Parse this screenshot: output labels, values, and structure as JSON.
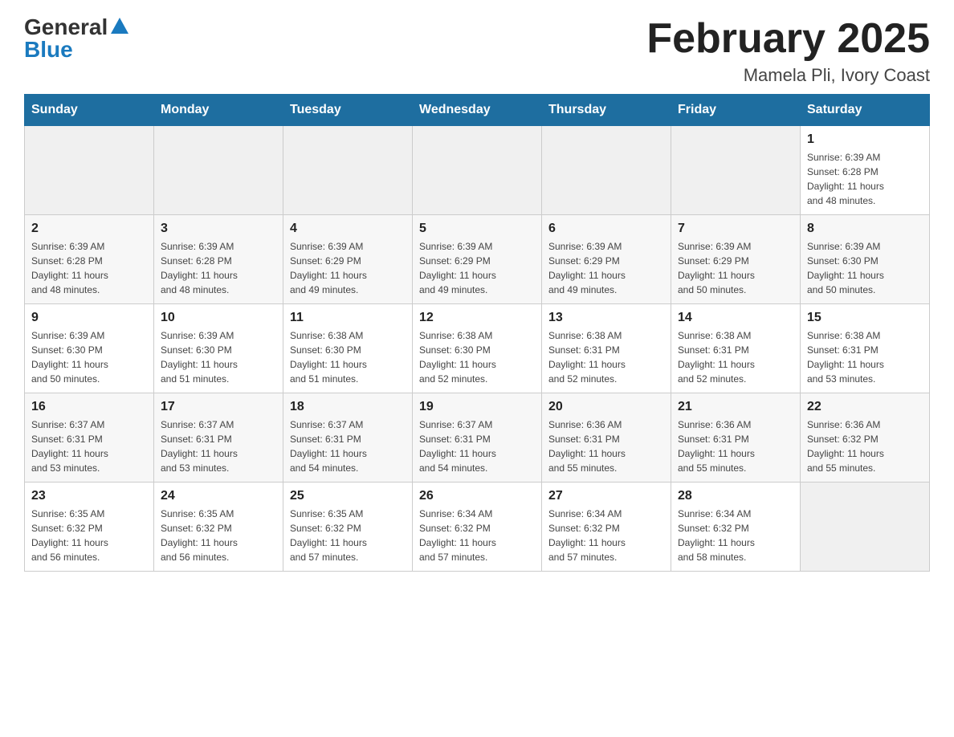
{
  "logo": {
    "general": "General",
    "blue": "Blue"
  },
  "title": "February 2025",
  "location": "Mamela Pli, Ivory Coast",
  "days_of_week": [
    "Sunday",
    "Monday",
    "Tuesday",
    "Wednesday",
    "Thursday",
    "Friday",
    "Saturday"
  ],
  "weeks": [
    [
      {
        "day": "",
        "detail": ""
      },
      {
        "day": "",
        "detail": ""
      },
      {
        "day": "",
        "detail": ""
      },
      {
        "day": "",
        "detail": ""
      },
      {
        "day": "",
        "detail": ""
      },
      {
        "day": "",
        "detail": ""
      },
      {
        "day": "1",
        "detail": "Sunrise: 6:39 AM\nSunset: 6:28 PM\nDaylight: 11 hours\nand 48 minutes."
      }
    ],
    [
      {
        "day": "2",
        "detail": "Sunrise: 6:39 AM\nSunset: 6:28 PM\nDaylight: 11 hours\nand 48 minutes."
      },
      {
        "day": "3",
        "detail": "Sunrise: 6:39 AM\nSunset: 6:28 PM\nDaylight: 11 hours\nand 48 minutes."
      },
      {
        "day": "4",
        "detail": "Sunrise: 6:39 AM\nSunset: 6:29 PM\nDaylight: 11 hours\nand 49 minutes."
      },
      {
        "day": "5",
        "detail": "Sunrise: 6:39 AM\nSunset: 6:29 PM\nDaylight: 11 hours\nand 49 minutes."
      },
      {
        "day": "6",
        "detail": "Sunrise: 6:39 AM\nSunset: 6:29 PM\nDaylight: 11 hours\nand 49 minutes."
      },
      {
        "day": "7",
        "detail": "Sunrise: 6:39 AM\nSunset: 6:29 PM\nDaylight: 11 hours\nand 50 minutes."
      },
      {
        "day": "8",
        "detail": "Sunrise: 6:39 AM\nSunset: 6:30 PM\nDaylight: 11 hours\nand 50 minutes."
      }
    ],
    [
      {
        "day": "9",
        "detail": "Sunrise: 6:39 AM\nSunset: 6:30 PM\nDaylight: 11 hours\nand 50 minutes."
      },
      {
        "day": "10",
        "detail": "Sunrise: 6:39 AM\nSunset: 6:30 PM\nDaylight: 11 hours\nand 51 minutes."
      },
      {
        "day": "11",
        "detail": "Sunrise: 6:38 AM\nSunset: 6:30 PM\nDaylight: 11 hours\nand 51 minutes."
      },
      {
        "day": "12",
        "detail": "Sunrise: 6:38 AM\nSunset: 6:30 PM\nDaylight: 11 hours\nand 52 minutes."
      },
      {
        "day": "13",
        "detail": "Sunrise: 6:38 AM\nSunset: 6:31 PM\nDaylight: 11 hours\nand 52 minutes."
      },
      {
        "day": "14",
        "detail": "Sunrise: 6:38 AM\nSunset: 6:31 PM\nDaylight: 11 hours\nand 52 minutes."
      },
      {
        "day": "15",
        "detail": "Sunrise: 6:38 AM\nSunset: 6:31 PM\nDaylight: 11 hours\nand 53 minutes."
      }
    ],
    [
      {
        "day": "16",
        "detail": "Sunrise: 6:37 AM\nSunset: 6:31 PM\nDaylight: 11 hours\nand 53 minutes."
      },
      {
        "day": "17",
        "detail": "Sunrise: 6:37 AM\nSunset: 6:31 PM\nDaylight: 11 hours\nand 53 minutes."
      },
      {
        "day": "18",
        "detail": "Sunrise: 6:37 AM\nSunset: 6:31 PM\nDaylight: 11 hours\nand 54 minutes."
      },
      {
        "day": "19",
        "detail": "Sunrise: 6:37 AM\nSunset: 6:31 PM\nDaylight: 11 hours\nand 54 minutes."
      },
      {
        "day": "20",
        "detail": "Sunrise: 6:36 AM\nSunset: 6:31 PM\nDaylight: 11 hours\nand 55 minutes."
      },
      {
        "day": "21",
        "detail": "Sunrise: 6:36 AM\nSunset: 6:31 PM\nDaylight: 11 hours\nand 55 minutes."
      },
      {
        "day": "22",
        "detail": "Sunrise: 6:36 AM\nSunset: 6:32 PM\nDaylight: 11 hours\nand 55 minutes."
      }
    ],
    [
      {
        "day": "23",
        "detail": "Sunrise: 6:35 AM\nSunset: 6:32 PM\nDaylight: 11 hours\nand 56 minutes."
      },
      {
        "day": "24",
        "detail": "Sunrise: 6:35 AM\nSunset: 6:32 PM\nDaylight: 11 hours\nand 56 minutes."
      },
      {
        "day": "25",
        "detail": "Sunrise: 6:35 AM\nSunset: 6:32 PM\nDaylight: 11 hours\nand 57 minutes."
      },
      {
        "day": "26",
        "detail": "Sunrise: 6:34 AM\nSunset: 6:32 PM\nDaylight: 11 hours\nand 57 minutes."
      },
      {
        "day": "27",
        "detail": "Sunrise: 6:34 AM\nSunset: 6:32 PM\nDaylight: 11 hours\nand 57 minutes."
      },
      {
        "day": "28",
        "detail": "Sunrise: 6:34 AM\nSunset: 6:32 PM\nDaylight: 11 hours\nand 58 minutes."
      },
      {
        "day": "",
        "detail": ""
      }
    ]
  ]
}
